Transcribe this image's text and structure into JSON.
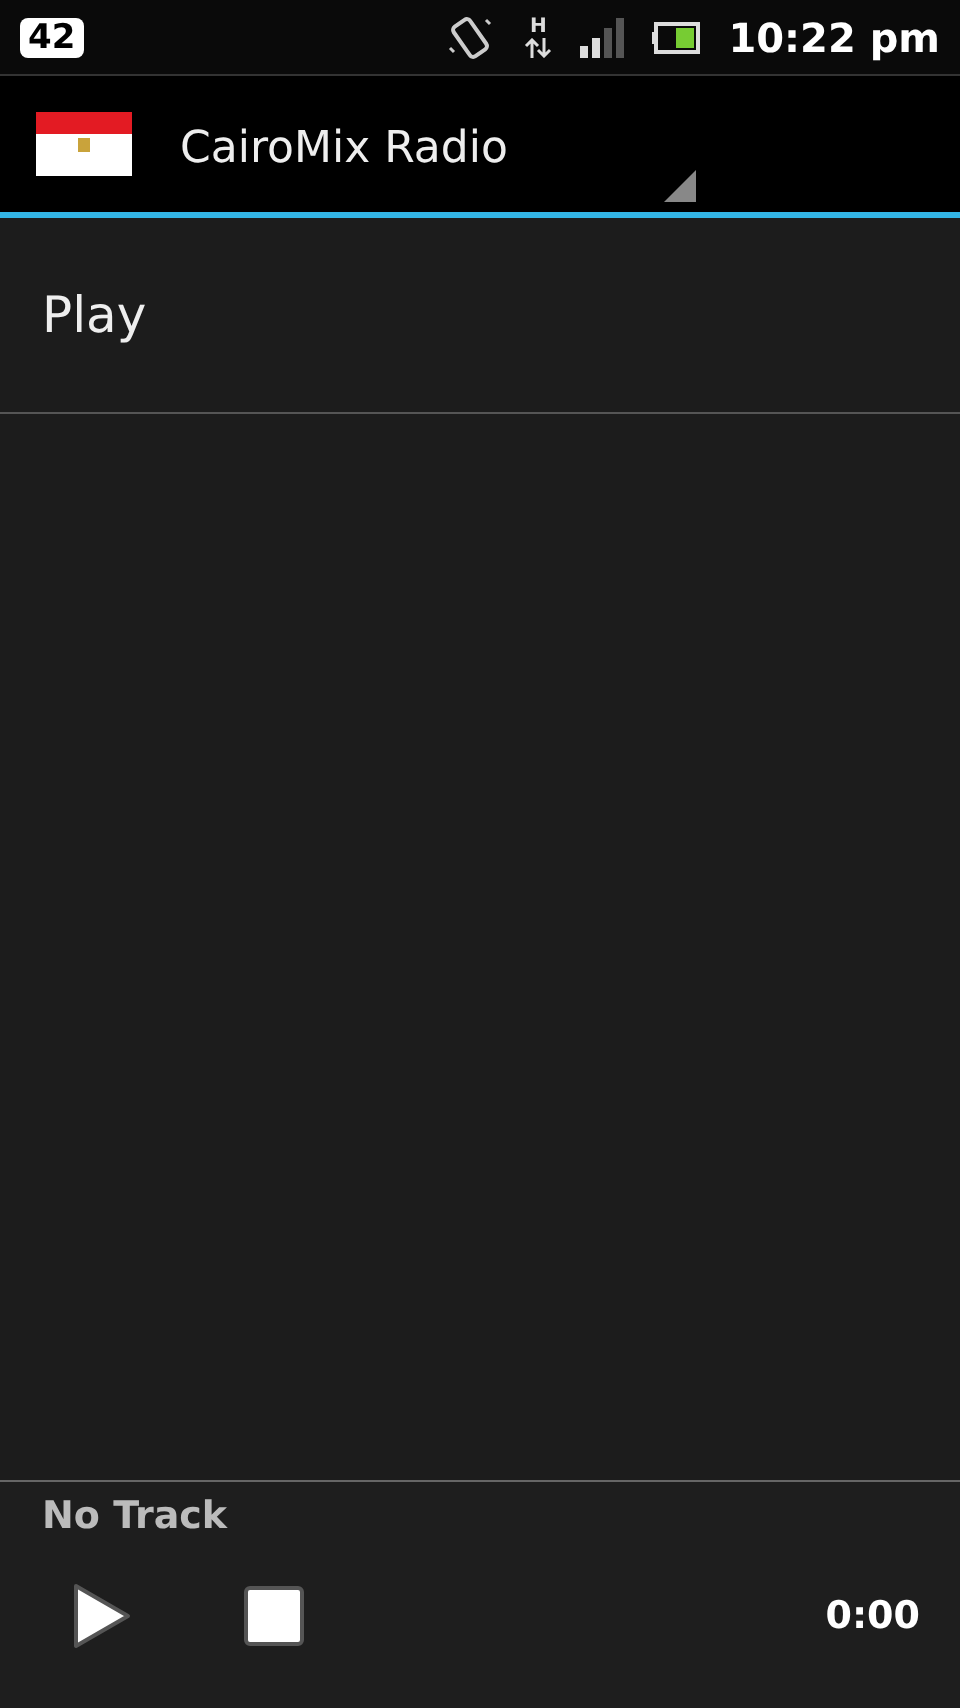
{
  "status_bar": {
    "notification_count": "42",
    "network_type": "H",
    "time": "10:22 pm"
  },
  "action_bar": {
    "title": "CairoMix Radio"
  },
  "list": [
    {
      "label": "Play"
    }
  ],
  "player": {
    "track": "No Track",
    "time": "0:00"
  }
}
